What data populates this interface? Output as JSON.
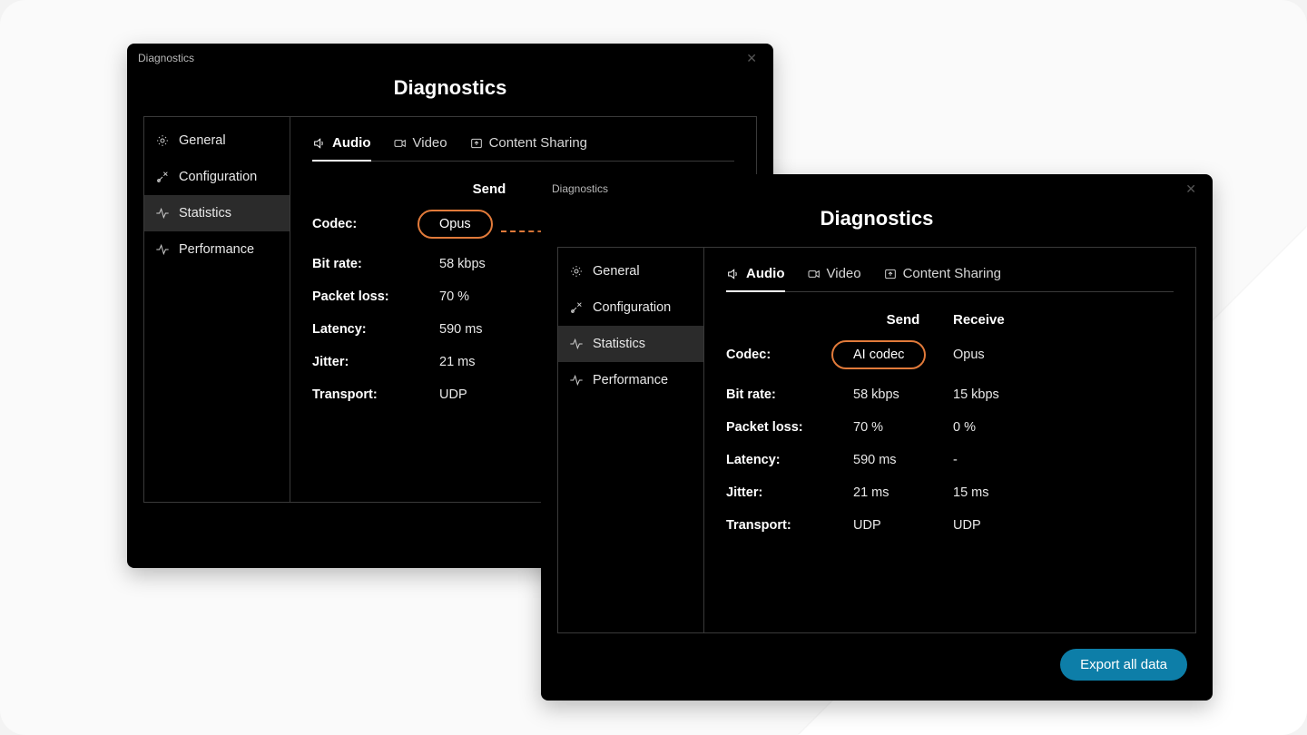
{
  "colors": {
    "accent": "#e17a3a",
    "export": "#0d7ea8"
  },
  "window_title": "Diagnostics",
  "heading": "Diagnostics",
  "sidebar": {
    "items": [
      {
        "label": "General",
        "icon": "gear-icon"
      },
      {
        "label": "Configuration",
        "icon": "tools-icon"
      },
      {
        "label": "Statistics",
        "icon": "activity-icon"
      },
      {
        "label": "Performance",
        "icon": "activity-icon"
      }
    ],
    "selected_index": 2
  },
  "tabs": {
    "items": [
      {
        "label": "Audio",
        "icon": "speaker-icon"
      },
      {
        "label": "Video",
        "icon": "camera-icon"
      },
      {
        "label": "Content Sharing",
        "icon": "share-icon"
      }
    ],
    "active_index": 0
  },
  "columns": {
    "send": "Send",
    "receive": "Receive"
  },
  "rows": [
    {
      "key": "Codec:"
    },
    {
      "key": "Bit rate:"
    },
    {
      "key": "Packet loss:"
    },
    {
      "key": "Latency:"
    },
    {
      "key": "Jitter:"
    },
    {
      "key": "Transport:"
    }
  ],
  "window1": {
    "send": {
      "codec": "Opus",
      "bitrate": "58 kbps",
      "packet_loss": "70 %",
      "latency": "590 ms",
      "jitter": "21 ms",
      "transport": "UDP"
    }
  },
  "window2": {
    "send": {
      "codec": "AI codec",
      "bitrate": "58 kbps",
      "packet_loss": "70 %",
      "latency": "590 ms",
      "jitter": "21 ms",
      "transport": "UDP"
    },
    "receive": {
      "codec": "Opus",
      "bitrate": "15 kbps",
      "packet_loss": "0 %",
      "latency": "-",
      "jitter": "15 ms",
      "transport": "UDP"
    }
  },
  "export_label": "Export all data"
}
